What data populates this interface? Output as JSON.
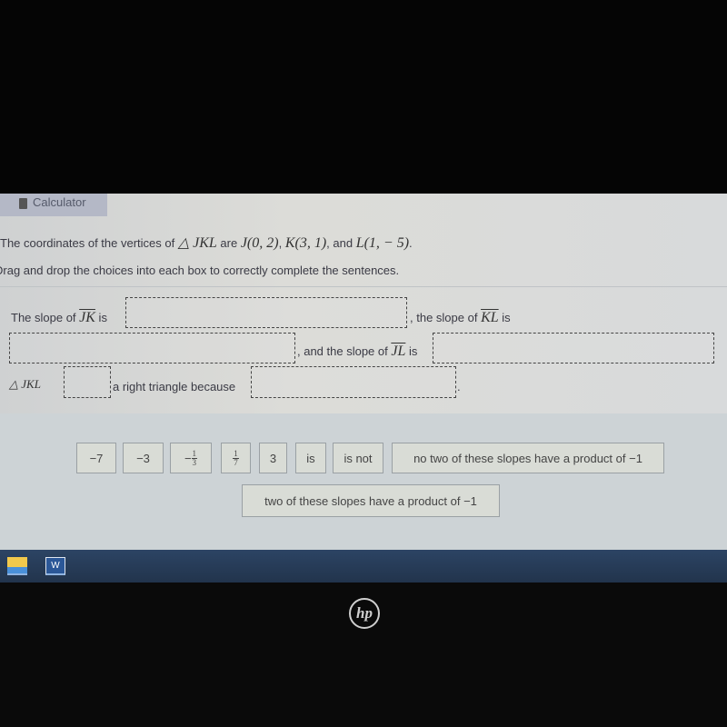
{
  "toolbar": {
    "calculator_label": "Calculator",
    "calculator_icon": "calculator-icon"
  },
  "question": {
    "line1_prefix": "The coordinates of the vertices of ",
    "triangle": "△ JKL",
    "line1_are": " are ",
    "J": "J(0, 2)",
    "K": "K(3, 1)",
    "and": ", and ",
    "L": "L(1,  − 5)",
    "end": ".",
    "instruction": "Drag and drop the choices into each box to correctly complete the sentences."
  },
  "sentences": {
    "s1_prefix": "The slope of ",
    "JK": "JK",
    "is": " is",
    "s1_mid": ", the slope of ",
    "KL": "KL",
    "s1_end": " is",
    "s2_mid": ", and the slope of ",
    "JL": "JL",
    "s2_end": " is",
    "triangle": "△ JKL",
    "s3_mid": "a right triangle because",
    "s3_end": "."
  },
  "choices": {
    "c1": "−7",
    "c2": "−3",
    "c3_sign": "−",
    "c3_num": "1",
    "c3_den": "3",
    "c4_num": "1",
    "c4_den": "7",
    "c5": "3",
    "c6": "is",
    "c7": "is not",
    "c8": "no two of these slopes have a product of −1",
    "c9": "two of these slopes have a product of −1"
  },
  "taskbar": {
    "icons": [
      "file-explorer-icon",
      "word-icon"
    ]
  },
  "brand": {
    "logo": "hp"
  }
}
